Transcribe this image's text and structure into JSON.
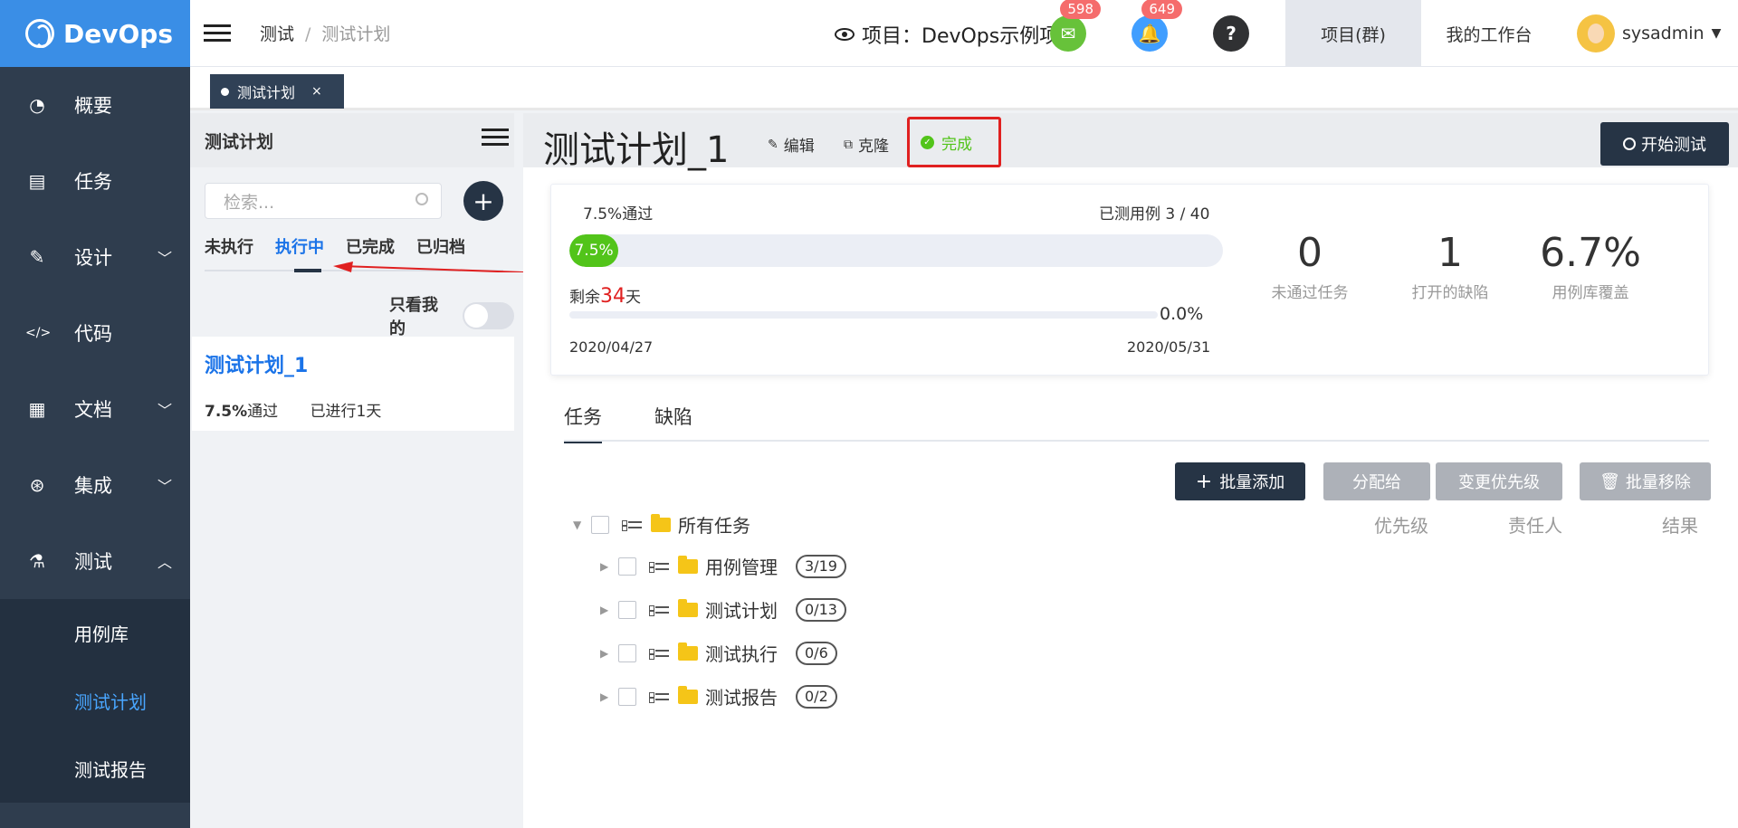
{
  "sidebar": {
    "brand": "DevOps",
    "items": [
      {
        "label": "概要",
        "icon": "dashboard-icon"
      },
      {
        "label": "任务",
        "icon": "task-icon"
      },
      {
        "label": "设计",
        "icon": "design-icon"
      },
      {
        "label": "代码",
        "icon": "code-icon"
      },
      {
        "label": "文档",
        "icon": "document-icon"
      },
      {
        "label": "集成",
        "icon": "integration-icon"
      },
      {
        "label": "测试",
        "icon": "flask-icon"
      }
    ],
    "submenu": [
      "用例库",
      "测试计划",
      "测试报告"
    ]
  },
  "topbar": {
    "breadcrumb": [
      "测试",
      "测试计划"
    ],
    "project_label": "项目：DevOps示例项目",
    "badge_messages": "598",
    "badge_notifications": "649",
    "help": "?",
    "nav_project_group": "项目(群)",
    "nav_workbench": "我的工作台",
    "username": "sysadmin"
  },
  "tabstrip": {
    "tab_label": "测试计划",
    "close": "×"
  },
  "leftpanel": {
    "title": "测试计划",
    "search_placeholder": "检索...",
    "add": "+",
    "tabs": [
      "未执行",
      "执行中",
      "已完成",
      "已归档"
    ],
    "active_tab": "执行中",
    "only_mine": "只看我的",
    "plan": {
      "name": "测试计划_1",
      "pass_value": "7.5%",
      "pass_label": "通过",
      "elapsed": "已进行1天"
    }
  },
  "main": {
    "title": "测试计划_1",
    "edit": "编辑",
    "clone": "克隆",
    "complete": "完成",
    "start": "开始测试",
    "stats": {
      "pass_text": "7.5%通过",
      "cases_text": "已测用例 3 / 40",
      "pass_bar_label": "7.5%",
      "pass_fraction": 0.075,
      "remain_prefix": "剩余",
      "remain_days": "34",
      "remain_suffix": "天",
      "time_pct": "0.0%",
      "time_fraction": 0.0,
      "start_date": "2020/04/27",
      "end_date": "2020/05/31",
      "kpis": [
        {
          "value": "0",
          "label": "未通过任务"
        },
        {
          "value": "1",
          "label": "打开的缺陷"
        },
        {
          "value": "6.7%",
          "label": "用例库覆盖"
        }
      ]
    },
    "tabs": [
      "任务",
      "缺陷"
    ],
    "buttons": {
      "batch_add": "批量添加",
      "assign": "分配给",
      "priority": "变更优先级",
      "batch_remove": "批量移除"
    },
    "tree": {
      "root": "所有任务",
      "columns": [
        "优先级",
        "责任人",
        "结果"
      ],
      "rows": [
        {
          "name": "用例管理",
          "count": "3/19"
        },
        {
          "name": "测试计划",
          "count": "0/13"
        },
        {
          "name": "测试执行",
          "count": "0/6"
        },
        {
          "name": "测试报告",
          "count": "0/2"
        }
      ]
    }
  },
  "colors": {
    "accent": "#3a8ee6",
    "dark": "#263445",
    "success": "#52c41a",
    "danger": "#e02020",
    "sidebar": "#2f3d4e"
  }
}
